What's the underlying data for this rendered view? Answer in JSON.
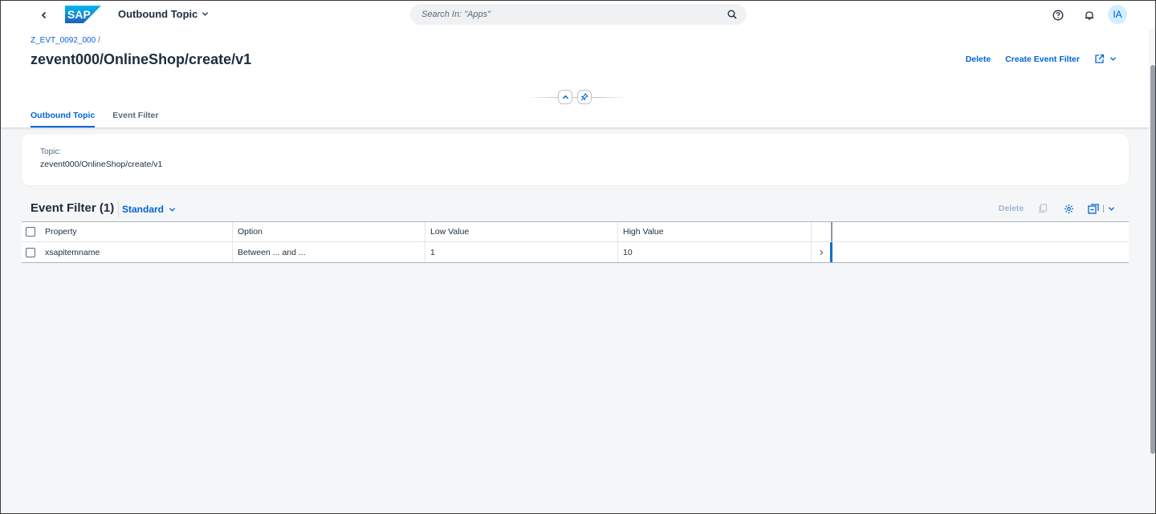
{
  "shell": {
    "app_title": "Outbound Topic",
    "search_placeholder": "Search In: \"Apps\"",
    "avatar_initials": "IA",
    "logo_text": "SAP"
  },
  "header": {
    "breadcrumb": "Z_EVT_0092_000",
    "breadcrumb_separator": "/",
    "title": "zevent000/OnlineShop/create/v1",
    "actions": {
      "delete": "Delete",
      "create_filter": "Create Event Filter"
    },
    "tabs": [
      {
        "label": "Outbound Topic",
        "active": true
      },
      {
        "label": "Event Filter",
        "active": false
      }
    ]
  },
  "topic_card": {
    "label": "Topic:",
    "value": "zevent000/OnlineShop/create/v1"
  },
  "event_filter": {
    "title": "Event Filter (1)",
    "variant": "Standard",
    "delete_label": "Delete",
    "columns": [
      "Property",
      "Option",
      "Low Value",
      "High Value"
    ],
    "rows": [
      {
        "property": "xsapitemname",
        "option": "Between ... and ...",
        "low": "1",
        "high": "10"
      }
    ]
  },
  "colors": {
    "brand_blue": "#0064d9",
    "text": "#1d2d3e",
    "background": "#f5f6f7"
  }
}
